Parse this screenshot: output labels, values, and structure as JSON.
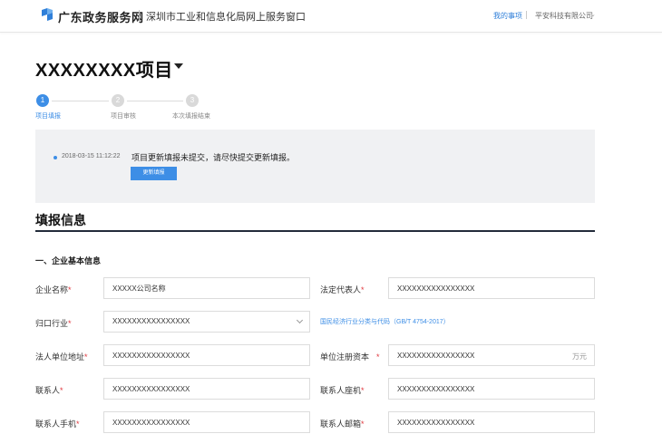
{
  "header": {
    "brand": "广东政务服务网",
    "portal": "深圳市工业和信息化局网上服务窗口",
    "my_items": "我的事项",
    "company": "平安科技有限公司"
  },
  "project": {
    "title": "XXXXXXXX项目"
  },
  "steps": [
    {
      "number": "1",
      "label": "项目填报",
      "state": "active"
    },
    {
      "number": "2",
      "label": "项目审核",
      "state": "pending"
    },
    {
      "number": "3",
      "label": "本次填报结束",
      "state": "pending"
    }
  ],
  "notice": {
    "time": "2018-03-15 11:12:22",
    "message": "项目更新填报未提交，请尽快提交更新填报。",
    "button": "更新填报"
  },
  "section": {
    "title": "填报信息",
    "subsection": "一、企业基本信息"
  },
  "form": {
    "company_name": {
      "label": "企业名称",
      "value": "XXXXX公司名称"
    },
    "legal_rep": {
      "label": "法定代表人",
      "value": "XXXXXXXXXXXXXXXX"
    },
    "industry": {
      "label": "归口行业",
      "value": "XXXXXXXXXXXXXXXX",
      "hint": "国民经济行业分类与代码（GB/T 4754-2017）"
    },
    "address": {
      "label": "法人单位地址",
      "value": "XXXXXXXXXXXXXXXX"
    },
    "capital": {
      "label": "单位注册资本",
      "value": "XXXXXXXXXXXXXXXX",
      "unit": "万元"
    },
    "contact": {
      "label": "联系人",
      "value": "XXXXXXXXXXXXXXXX"
    },
    "contact_phone": {
      "label": "联系人座机",
      "value": "XXXXXXXXXXXXXXXX"
    },
    "contact_mobile": {
      "label": "联系人手机",
      "value": "XXXXXXXXXXXXXXXX"
    },
    "contact_email": {
      "label": "联系人邮箱",
      "value": "XXXXXXXXXXXXXXXX"
    },
    "required_mark": "*"
  },
  "colors": {
    "accent": "#3d8ee6",
    "required": "#e0383e"
  }
}
